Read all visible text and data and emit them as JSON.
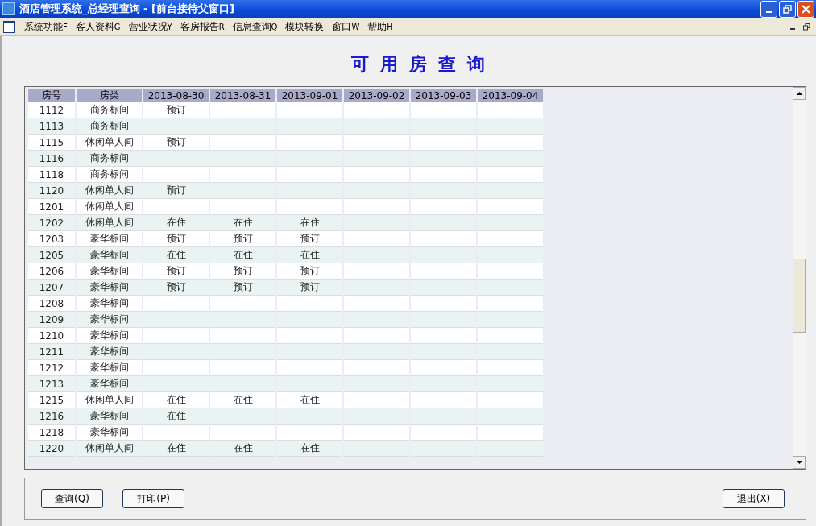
{
  "window": {
    "title": "酒店管理系统_总经理查询 - [前台接待父窗口]"
  },
  "menu": [
    {
      "label": "系统功能",
      "key": "F"
    },
    {
      "label": "客人资料",
      "key": "G"
    },
    {
      "label": "营业状况",
      "key": "Y"
    },
    {
      "label": "客房报告",
      "key": "R"
    },
    {
      "label": "信息查询",
      "key": "Q"
    },
    {
      "label": "模块转换"
    },
    {
      "label": "窗口",
      "key": "W"
    },
    {
      "label": "帮助",
      "key": "H"
    }
  ],
  "page_title": "可用房查询",
  "table": {
    "columns": [
      "房号",
      "房类",
      "2013-08-30",
      "2013-08-31",
      "2013-09-01",
      "2013-09-02",
      "2013-09-03",
      "2013-09-04"
    ],
    "rows": [
      [
        "1112",
        "商务标间",
        "预订",
        "",
        "",
        "",
        "",
        ""
      ],
      [
        "1113",
        "商务标间",
        "",
        "",
        "",
        "",
        "",
        ""
      ],
      [
        "1115",
        "休闲单人间",
        "预订",
        "",
        "",
        "",
        "",
        ""
      ],
      [
        "1116",
        "商务标间",
        "",
        "",
        "",
        "",
        "",
        ""
      ],
      [
        "1118",
        "商务标间",
        "",
        "",
        "",
        "",
        "",
        ""
      ],
      [
        "1120",
        "休闲单人间",
        "预订",
        "",
        "",
        "",
        "",
        ""
      ],
      [
        "1201",
        "休闲单人间",
        "",
        "",
        "",
        "",
        "",
        ""
      ],
      [
        "1202",
        "休闲单人间",
        "在住",
        "在住",
        "在住",
        "",
        "",
        ""
      ],
      [
        "1203",
        "豪华标间",
        "预订",
        "预订",
        "预订",
        "",
        "",
        ""
      ],
      [
        "1205",
        "豪华标间",
        "在住",
        "在住",
        "在住",
        "",
        "",
        ""
      ],
      [
        "1206",
        "豪华标间",
        "预订",
        "预订",
        "预订",
        "",
        "",
        ""
      ],
      [
        "1207",
        "豪华标间",
        "预订",
        "预订",
        "预订",
        "",
        "",
        ""
      ],
      [
        "1208",
        "豪华标间",
        "",
        "",
        "",
        "",
        "",
        ""
      ],
      [
        "1209",
        "豪华标间",
        "",
        "",
        "",
        "",
        "",
        ""
      ],
      [
        "1210",
        "豪华标间",
        "",
        "",
        "",
        "",
        "",
        ""
      ],
      [
        "1211",
        "豪华标间",
        "",
        "",
        "",
        "",
        "",
        ""
      ],
      [
        "1212",
        "豪华标间",
        "",
        "",
        "",
        "",
        "",
        ""
      ],
      [
        "1213",
        "豪华标间",
        "",
        "",
        "",
        "",
        "",
        ""
      ],
      [
        "1215",
        "休闲单人间",
        "在住",
        "在住",
        "在住",
        "",
        "",
        ""
      ],
      [
        "1216",
        "豪华标间",
        "在住",
        "",
        "",
        "",
        "",
        ""
      ],
      [
        "1218",
        "豪华标间",
        "",
        "",
        "",
        "",
        "",
        ""
      ],
      [
        "1220",
        "休闲单人间",
        "在住",
        "在住",
        "在住",
        "",
        "",
        ""
      ]
    ]
  },
  "left_buttons": [
    {
      "label": "查询(",
      "key": "Q",
      "suffix": ")"
    },
    {
      "label": "打印(",
      "key": "P",
      "suffix": ")"
    }
  ],
  "right_buttons": [
    {
      "label": "退出(",
      "key": "X",
      "suffix": ")"
    }
  ]
}
